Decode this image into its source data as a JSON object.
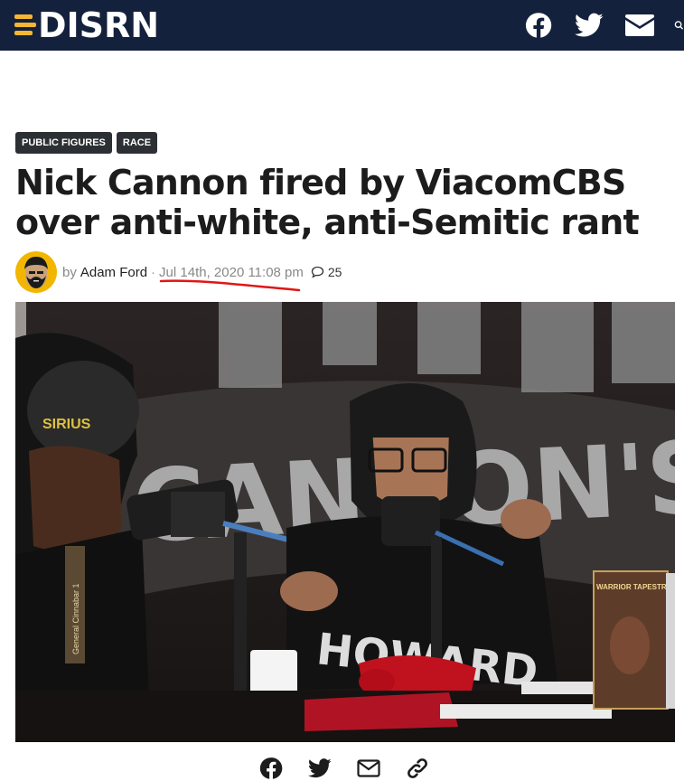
{
  "header": {
    "logo_text": "DISRN",
    "brand_colors": {
      "bar": "#13213c",
      "accent": "#f4b731"
    },
    "social_icons": [
      "facebook-icon",
      "twitter-icon",
      "envelope-icon",
      "search-icon"
    ]
  },
  "article": {
    "tags": [
      "PUBLIC FIGURES",
      "RACE"
    ],
    "title": "Nick Cannon fired by ViacomCBS over anti-white, anti-Semitic rant",
    "byline": {
      "by_label": "by",
      "author": "Adam Ford",
      "separator": "·",
      "date": "Jul 14th, 2020 11:08 pm",
      "comment_count": "25"
    },
    "image": {
      "cap_text": "SIRIUS",
      "shirt_text": "HOWARD",
      "wall_text": "CANNON'S",
      "book_text": "WARRIOR TAPESTRY",
      "book_spine_text": "General Cinnabar 1"
    }
  },
  "share_icons": [
    "facebook-icon",
    "twitter-icon",
    "envelope-icon",
    "link-icon"
  ]
}
